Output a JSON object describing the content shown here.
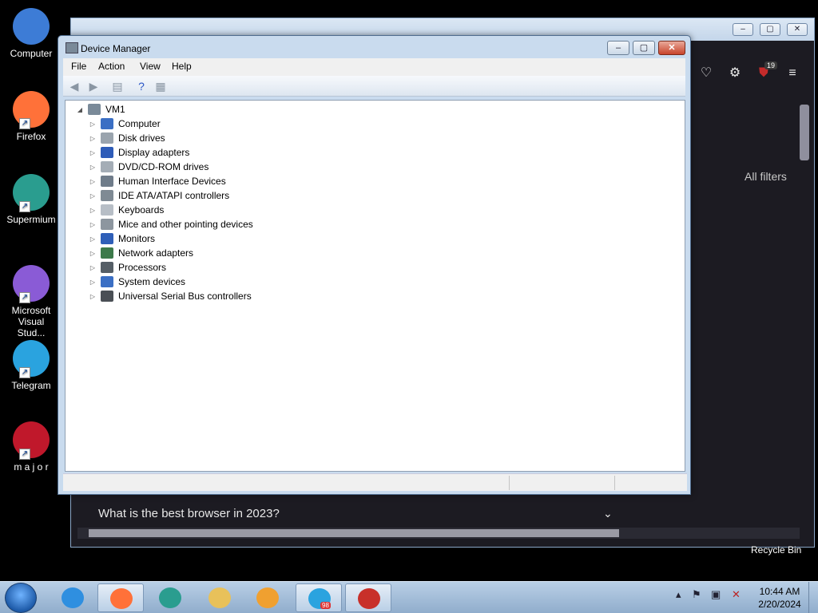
{
  "desktop": {
    "icons": [
      {
        "label": "Computer",
        "icon": "computer-icon",
        "color": "#3d7cd6"
      },
      {
        "label": "Firefox",
        "icon": "firefox-icon",
        "color": "#ff7139"
      },
      {
        "label": "Supermium",
        "icon": "supermium-icon",
        "color": "#2a9d8f"
      },
      {
        "label": "Microsoft Visual Stud...",
        "icon": "visual-studio-icon",
        "color": "#8a5bd6"
      },
      {
        "label": "Telegram",
        "icon": "telegram-icon",
        "color": "#2aa3df"
      },
      {
        "label": "m a j o r",
        "icon": "vinyl-record-icon",
        "color": "#c0182b"
      }
    ],
    "recycle_bin": "Recycle Bin"
  },
  "browser": {
    "all_filters": "All filters",
    "badge": "19",
    "faq_question": "What is the best browser in 2023?"
  },
  "device_manager": {
    "title": "Device Manager",
    "menu": [
      "File",
      "Action",
      "View",
      "Help"
    ],
    "root": "VM1",
    "nodes": [
      {
        "label": "Computer",
        "icon": "computer-icon",
        "color": "#3b6fc4"
      },
      {
        "label": "Disk drives",
        "icon": "disk-drive-icon",
        "color": "#9aa4ae"
      },
      {
        "label": "Display adapters",
        "icon": "display-adapter-icon",
        "color": "#2e5cb8"
      },
      {
        "label": "DVD/CD-ROM drives",
        "icon": "dvd-drive-icon",
        "color": "#a4adb6"
      },
      {
        "label": "Human Interface Devices",
        "icon": "hid-icon",
        "color": "#6f7c8a"
      },
      {
        "label": "IDE ATA/ATAPI controllers",
        "icon": "ide-controller-icon",
        "color": "#7f8a94"
      },
      {
        "label": "Keyboards",
        "icon": "keyboard-icon",
        "color": "#b7bec6"
      },
      {
        "label": "Mice and other pointing devices",
        "icon": "mouse-icon",
        "color": "#8d969f"
      },
      {
        "label": "Monitors",
        "icon": "monitor-icon",
        "color": "#2f5fb8"
      },
      {
        "label": "Network adapters",
        "icon": "network-adapter-icon",
        "color": "#3c7a4a"
      },
      {
        "label": "Processors",
        "icon": "processor-icon",
        "color": "#555e66"
      },
      {
        "label": "System devices",
        "icon": "system-devices-icon",
        "color": "#3b6fc4"
      },
      {
        "label": "Universal Serial Bus controllers",
        "icon": "usb-icon",
        "color": "#4a4f55"
      }
    ]
  },
  "taskbar": {
    "apps": [
      {
        "name": "internet-explorer",
        "icon": "internet-explorer-icon",
        "color": "#2f8fe0",
        "active": false
      },
      {
        "name": "firefox",
        "icon": "firefox-icon",
        "color": "#ff7139",
        "active": true
      },
      {
        "name": "supermium",
        "icon": "supermium-icon",
        "color": "#2a9d8f",
        "active": false
      },
      {
        "name": "file-explorer",
        "icon": "folder-icon",
        "color": "#e8c15a",
        "active": false
      },
      {
        "name": "media-player",
        "icon": "media-player-icon",
        "color": "#f0a030",
        "active": false
      },
      {
        "name": "telegram",
        "icon": "telegram-icon",
        "color": "#2aa3df",
        "active": true
      },
      {
        "name": "device-manager",
        "icon": "toolbox-icon",
        "color": "#c8302a",
        "active": true
      }
    ],
    "telegram_badge": "98",
    "time": "10:44 AM",
    "date": "2/20/2024"
  }
}
